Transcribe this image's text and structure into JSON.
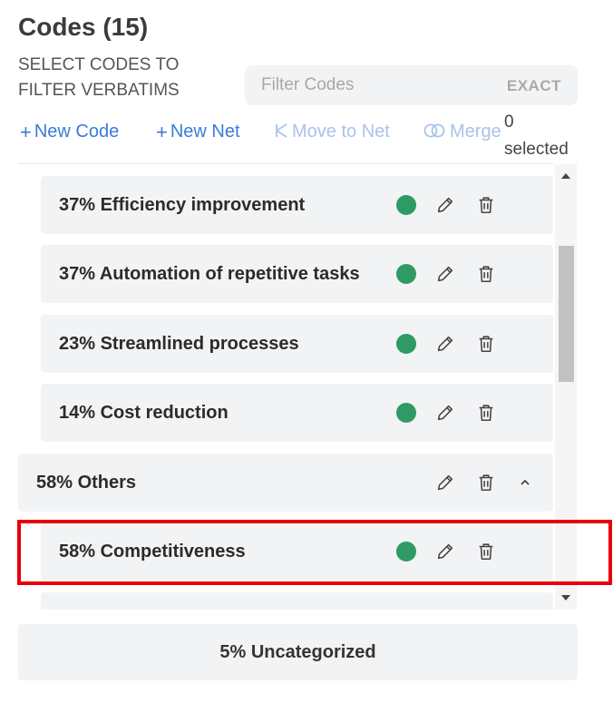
{
  "header": {
    "title": "Codes (15)",
    "subtitle": "SELECT CODES TO FILTER VERBATIMS"
  },
  "filter": {
    "placeholder": "Filter Codes",
    "value": "",
    "exact_label": "EXACT"
  },
  "toolbar": {
    "new_code": "New Code",
    "new_net": "New Net",
    "move_to_net": "Move to Net",
    "merge": "Merge",
    "selected_count": "0",
    "selected_label": "selected"
  },
  "colors": {
    "accent": "#3a7bd5",
    "status_green": "#2e9a64",
    "highlight": "#e8000b"
  },
  "codes": [
    {
      "label": "37% Efficiency improvement",
      "status": "green"
    },
    {
      "label": "37% Automation of repetitive tasks",
      "status": "green"
    },
    {
      "label": "23% Streamlined processes",
      "status": "green"
    },
    {
      "label": "14% Cost reduction",
      "status": "green"
    }
  ],
  "net": {
    "label": "58% Others",
    "expanded": true,
    "children": [
      {
        "label": "58% Competitiveness",
        "status": "green",
        "highlighted": true
      }
    ]
  },
  "uncategorized": {
    "label": "5% Uncategorized"
  },
  "icons": {
    "edit": "pencil-icon",
    "delete": "trash-icon",
    "collapse": "chevron-up-icon",
    "scroll_up": "scroll-up-arrow-icon",
    "scroll_down": "scroll-down-arrow-icon"
  }
}
